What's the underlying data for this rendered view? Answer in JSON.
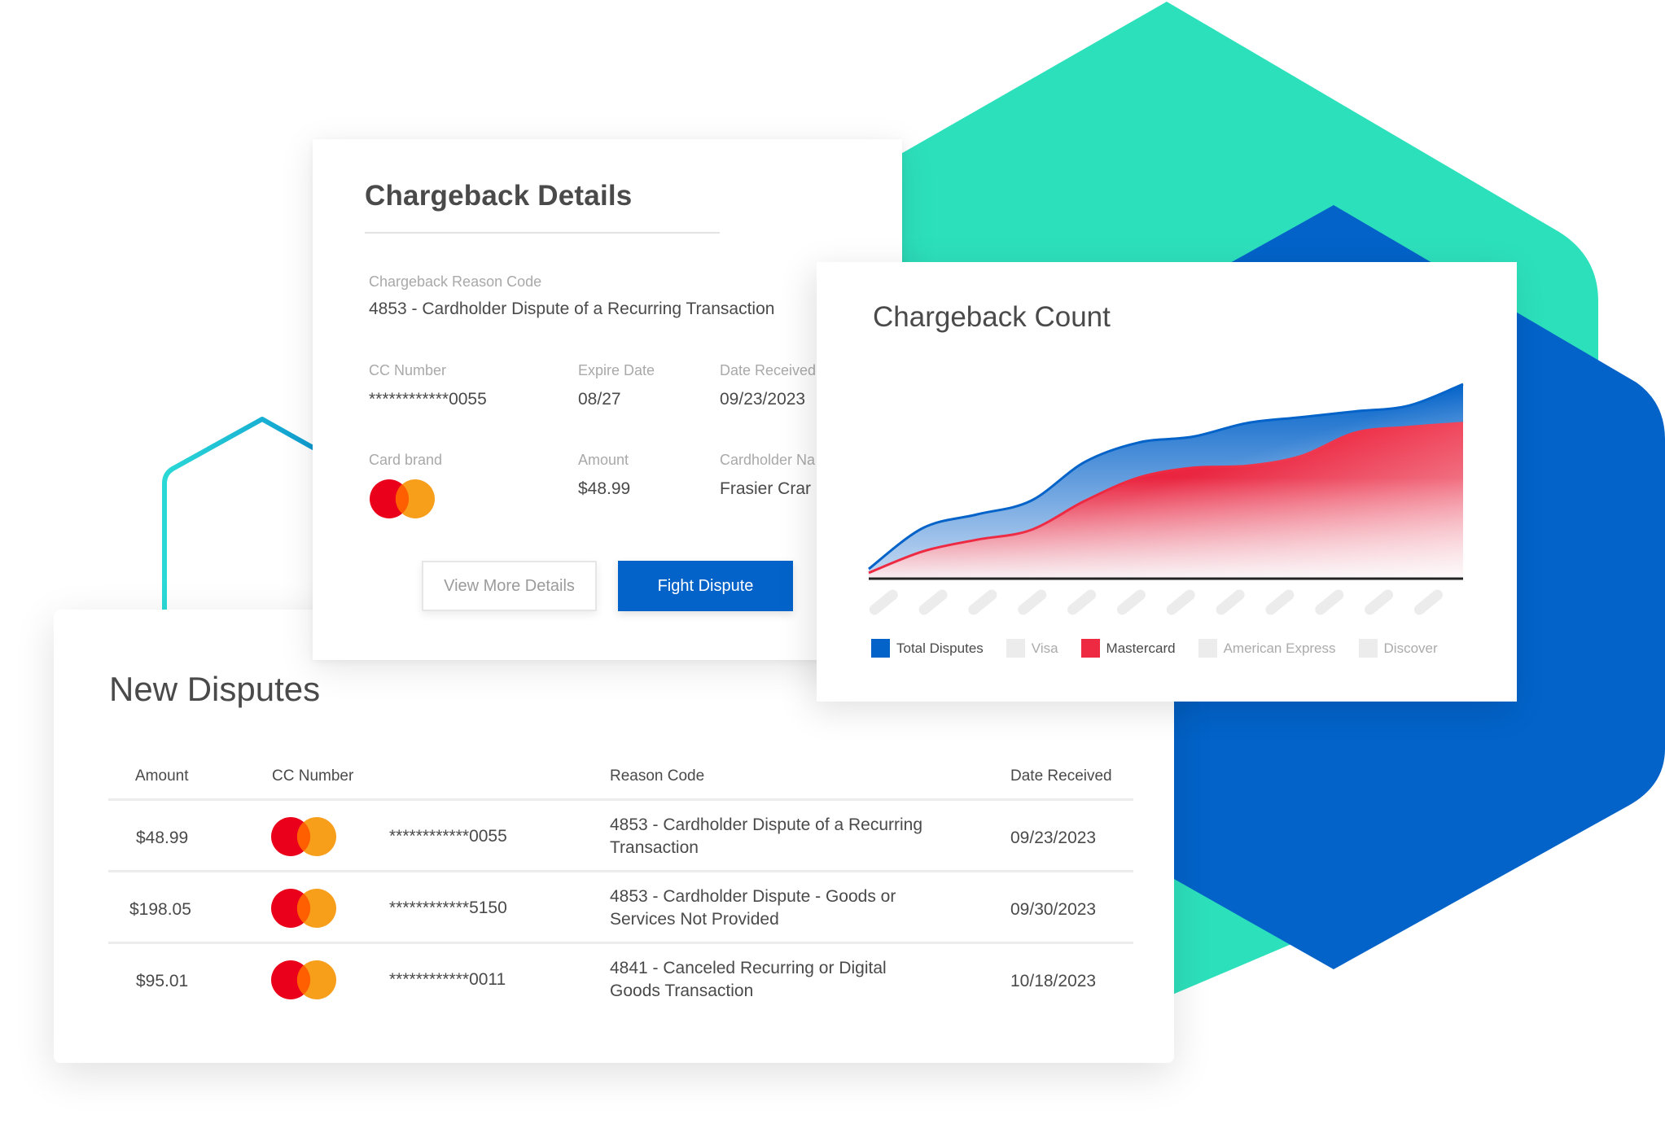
{
  "colors": {
    "teal_hex": "#2de0bc",
    "blue_hex": "#0363c9",
    "outline_hex_start": "#2ad9d6",
    "outline_hex_end": "#0a8fd0",
    "primary": "#0363c9",
    "mastercard_red": "#eb001b",
    "mastercard_orange": "#f79e1b",
    "mastercard_overlap": "#ff5f00",
    "total_disputes": "#0363c9",
    "mastercard_series": "#ee2a43",
    "inactive_legend": "#ececec"
  },
  "details": {
    "title": "Chargeback Details",
    "reason_code_label": "Chargeback Reason Code",
    "reason_code_value": "4853 - Cardholder Dispute of a Recurring Transaction",
    "cc_number_label": "CC Number",
    "cc_number_value": "************0055",
    "expire_date_label": "Expire Date",
    "expire_date_value": "08/27",
    "date_received_label": "Date Received",
    "date_received_value": "09/23/2023",
    "card_brand_label": "Card brand",
    "card_brand_value": "mastercard-icon",
    "amount_label": "Amount",
    "amount_value": "$48.99",
    "cardholder_name_label": "Cardholder Na",
    "cardholder_name_value": "Frasier Crar",
    "view_more_label": "View More Details",
    "fight_dispute_label": "Fight Dispute"
  },
  "chart_data": {
    "type": "area",
    "title": "Chargeback Count",
    "xlabel": "",
    "ylabel": "",
    "x": [
      1,
      2,
      3,
      4,
      5,
      6,
      7,
      8,
      9,
      10,
      11,
      12
    ],
    "x_tick_labels": [
      "",
      "",
      "",
      "",
      "",
      "",
      "",
      "",
      "",
      "",
      "",
      ""
    ],
    "ylim": [
      0,
      100
    ],
    "grid": false,
    "legend_position": "bottom",
    "series": [
      {
        "name": "Total Disputes",
        "active": true,
        "color": "#0363c9",
        "values": [
          5,
          26,
          33,
          40,
          60,
          70,
          73,
          80,
          83,
          86,
          89,
          100
        ]
      },
      {
        "name": "Visa",
        "active": false,
        "color": "#ececec",
        "values": []
      },
      {
        "name": "Mastercard",
        "active": true,
        "color": "#ee2a43",
        "values": [
          3,
          14,
          20,
          25,
          40,
          52,
          57,
          58,
          63,
          75,
          78,
          80
        ]
      },
      {
        "name": "American Express",
        "active": false,
        "color": "#ececec",
        "values": []
      },
      {
        "name": "Discover",
        "active": false,
        "color": "#ececec",
        "values": []
      }
    ]
  },
  "disputes": {
    "title": "New Disputes",
    "headers": {
      "amount": "Amount",
      "cc_number": "CC Number",
      "reason_code": "Reason Code",
      "date_received": "Date Received"
    },
    "rows": [
      {
        "amount": "$48.99",
        "brand": "mastercard-icon",
        "cc_number": "************0055",
        "reason_code": "4853 - Cardholder Dispute of a Recurring Transaction",
        "date_received": "09/23/2023"
      },
      {
        "amount": "$198.05",
        "brand": "mastercard-icon",
        "cc_number": "************5150",
        "reason_code": "4853 - Cardholder Dispute - Goods or Services Not Provided",
        "date_received": "09/30/2023"
      },
      {
        "amount": "$95.01",
        "brand": "mastercard-icon",
        "cc_number": "************0011",
        "reason_code": "4841 - Canceled Recurring or Digital Goods Transaction",
        "date_received": "10/18/2023"
      }
    ]
  }
}
